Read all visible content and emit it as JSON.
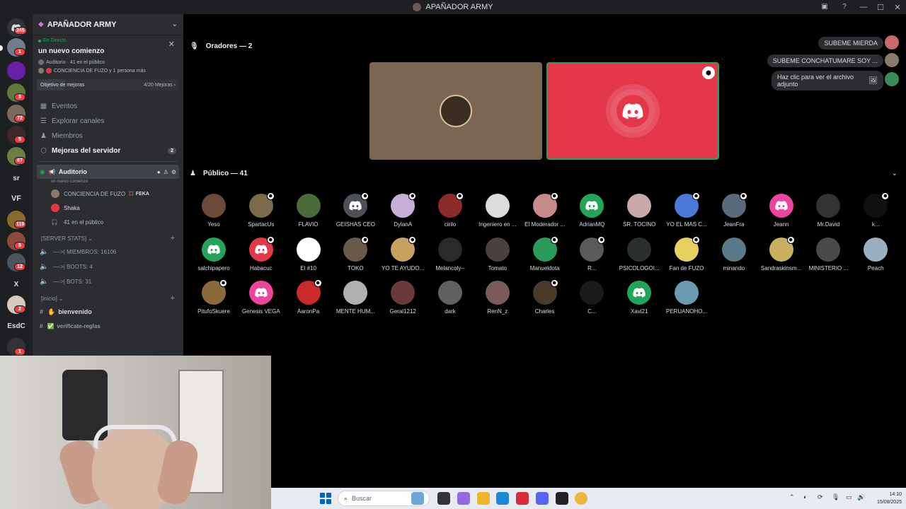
{
  "window": {
    "title": "APAÑADOR ARMY"
  },
  "rail": {
    "badges": [
      "245",
      "1",
      "3",
      "72",
      "5",
      "67",
      "119",
      "5",
      "12",
      "2",
      "1"
    ],
    "texts": [
      "sr",
      "VF",
      "X",
      "EsdC"
    ]
  },
  "server": {
    "name": "APAÑADOR ARMY",
    "live": {
      "status": "En Directo",
      "title": "un nuevo comienzo",
      "meta1": "Auditorio · 41 en el público",
      "meta2": "CONCIENCIA DE FUZO y 1 persona más"
    },
    "boost": {
      "label": "Objetivo de mejoras",
      "progress_text": "4/20 Mejoras",
      "progress": 0.2
    },
    "nav": [
      {
        "label": "Eventos",
        "icon": "calendar-icon"
      },
      {
        "label": "Explorar canales",
        "icon": "browse-icon"
      },
      {
        "label": "Miembros",
        "icon": "members-icon"
      },
      {
        "label": "Mejoras del servidor",
        "icon": "boost-icon",
        "badge": "2"
      }
    ],
    "active_channel": {
      "name": "Auditorio",
      "sub": "un nuevo comienzo"
    },
    "voice_users": [
      {
        "name": "CONCIENCIA DE FUZO",
        "tag": "FEKA"
      },
      {
        "name": "Shaka"
      }
    ],
    "audience_count": "41 en el público",
    "stats_category": "SERVER STATS",
    "stats": [
      "MIEMBROS: 16106",
      "BOOTS: 4",
      "BOTS: 31"
    ],
    "inicio_category": "inicio",
    "text_channels": [
      "bienvenido",
      "verificate-reglas"
    ]
  },
  "stage": {
    "speakers_label": "Oradores — 2",
    "audience_label": "Público — 41",
    "audience": [
      "Yeso",
      "SpartacUs",
      "FLAVIO",
      "GEISHAS CEO",
      "DylanA",
      "cirilo",
      "Ingeniero en ...",
      "El Moderador ...",
      "AdrianMQ",
      "SR. TOCINO",
      "YO EL MAS C...",
      "JeanFra",
      "Jeann",
      "Mr.David",
      "k...",
      "salchipapero",
      "Habacuc",
      "El #10",
      "TOKO",
      "YO TE AYUDO...",
      "Melancoly--",
      "Tomato",
      "Manueldota",
      "R...",
      "PSICOLOGOI...",
      "Fan de FUZO",
      "minando",
      "Sandraskinsm...",
      "MINISTERIO ...",
      "Peach",
      "PitufoSkuere",
      "Genesis VEGA",
      "AaronPa",
      "MENTE HUM...",
      "Geral1212",
      "dark",
      "RenN_z",
      "Charles",
      "C...",
      "Xavi21",
      "PERUANOHO..."
    ]
  },
  "notifications": [
    "SUBEME MIERDA",
    "SUBEME CONCHATUMARE SOY ...",
    "Haz clic para ver el archivo adjunto"
  ],
  "taskbar": {
    "search_placeholder": "Buscar",
    "time": "14:10",
    "date": "15/08/2025"
  },
  "colors": {
    "accent": "#5865f2",
    "live": "#23a559",
    "badge": "#f23f42",
    "speaker_tile": "#e3384a"
  }
}
